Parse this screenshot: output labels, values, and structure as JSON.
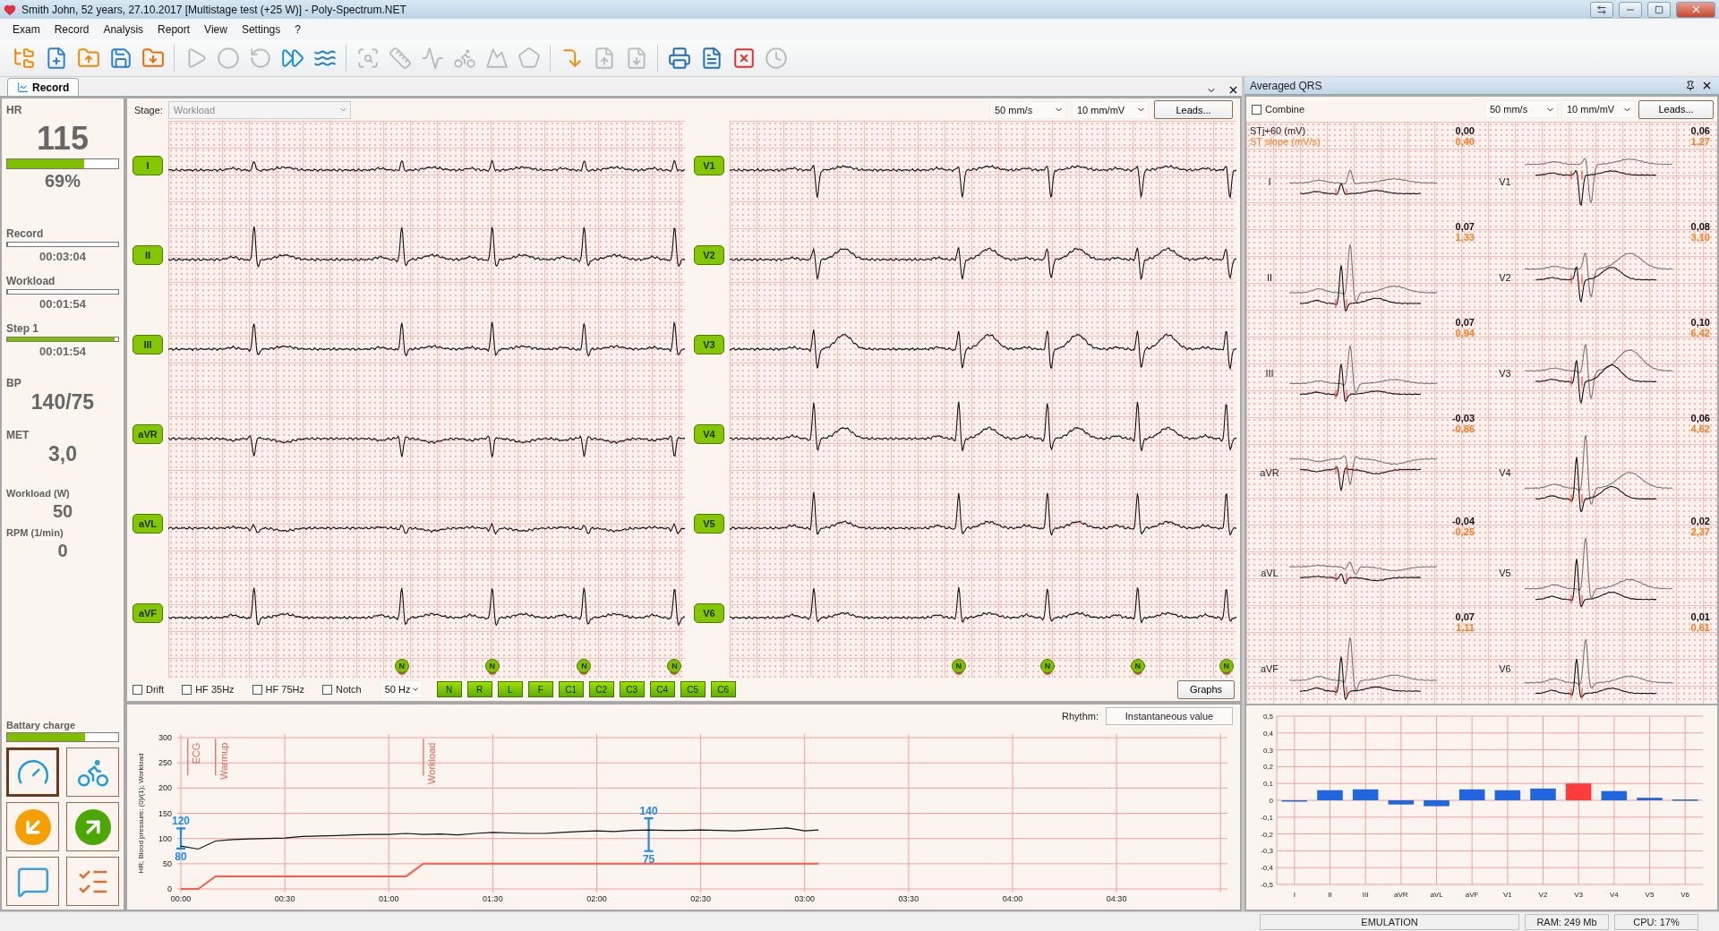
{
  "window": {
    "title": "Smith John, 52 years, 27.10.2017 [Multistage test (+25 W)] - Poly-Spectrum.NET"
  },
  "menu": [
    "Exam",
    "Record",
    "Analysis",
    "Report",
    "View",
    "Settings",
    "?"
  ],
  "toolbar": [
    {
      "kind": "folder-tree",
      "disabled": false
    },
    {
      "kind": "file-add",
      "disabled": false
    },
    {
      "kind": "folder-up",
      "disabled": false
    },
    {
      "kind": "save",
      "disabled": false
    },
    {
      "kind": "folder-down",
      "disabled": false
    },
    {
      "kind": "separator"
    },
    {
      "kind": "play",
      "disabled": true
    },
    {
      "kind": "stop",
      "disabled": true
    },
    {
      "kind": "undo",
      "disabled": true
    },
    {
      "kind": "fast-forward",
      "disabled": false
    },
    {
      "kind": "waves",
      "disabled": false
    },
    {
      "kind": "separator"
    },
    {
      "kind": "scan",
      "disabled": true
    },
    {
      "kind": "ruler",
      "disabled": true
    },
    {
      "kind": "pulse",
      "disabled": true
    },
    {
      "kind": "bicycle",
      "disabled": true
    },
    {
      "kind": "histogram",
      "disabled": true
    },
    {
      "kind": "pentagon",
      "disabled": true
    },
    {
      "kind": "separator"
    },
    {
      "kind": "step-down",
      "disabled": false
    },
    {
      "kind": "file-up",
      "disabled": true
    },
    {
      "kind": "file-down",
      "disabled": true
    },
    {
      "kind": "separator"
    },
    {
      "kind": "printer",
      "disabled": false
    },
    {
      "kind": "report",
      "disabled": false
    },
    {
      "kind": "close-window",
      "disabled": false
    },
    {
      "kind": "clock",
      "disabled": true
    }
  ],
  "document_tabs": [
    {
      "label": "Record",
      "selected": true
    }
  ],
  "sidebar": {
    "hr": {
      "label": "HR",
      "value": "115",
      "level": 0.69,
      "percent": "69%"
    },
    "timers": [
      {
        "label": "Record",
        "level": 0,
        "time": "00:03:04"
      },
      {
        "label": "Workload",
        "level": 0,
        "time": "00:01:54"
      },
      {
        "label": "Step 1",
        "level": 0.97,
        "time": "00:01:54"
      }
    ],
    "readings": [
      {
        "label": "BP",
        "value": "140/75",
        "kind": "large"
      },
      {
        "label": "MET",
        "value": "3,0",
        "kind": "large"
      },
      {
        "label": "Workload (W)",
        "value": "50",
        "kind": "small"
      },
      {
        "label": "RPM (1/min)",
        "value": "0",
        "kind": "small"
      }
    ],
    "battery": {
      "label": "Battary charge",
      "level": 0.7
    },
    "controls": [
      {
        "kind": "bp-monitor",
        "selected": true
      },
      {
        "kind": "bicycle",
        "selected": false
      },
      {
        "kind": "arrow-down-left",
        "selected": false
      },
      {
        "kind": "arrow-up-right",
        "selected": false
      },
      {
        "kind": "message",
        "selected": false
      },
      {
        "kind": "options-list",
        "selected": false
      }
    ]
  },
  "ecg": {
    "stage_label": "Stage:",
    "stage": {
      "value": "Workload",
      "disabled": true
    },
    "speed": "50 mm/s",
    "gain": "10 mm/mV",
    "leads_button": "Leads...",
    "columns": [
      {
        "leads": [
          "I",
          "II",
          "III",
          "aVR",
          "aVL",
          "aVF"
        ],
        "beat_marks": [
          "N",
          "N",
          "N",
          "N"
        ]
      },
      {
        "leads": [
          "V1",
          "V2",
          "V3",
          "V4",
          "V5",
          "V6"
        ],
        "beat_marks": [
          "N",
          "N",
          "N",
          "N"
        ]
      }
    ],
    "filters": [
      {
        "label": "Drift",
        "checked": false
      },
      {
        "label": "HF 35Hz",
        "checked": false
      },
      {
        "label": "HF 75Hz",
        "checked": false
      },
      {
        "label": "Notch",
        "checked": false
      }
    ],
    "mains": "50 Hz",
    "lead_buttons": [
      "N",
      "R",
      "L",
      "F",
      "C1",
      "C2",
      "C3",
      "C4",
      "C5",
      "C6"
    ],
    "graphs_button": "Graphs"
  },
  "trend": {
    "rhythm_label": "Rhythm:",
    "rhythm_mode": "Instantaneous value",
    "stage_marks": [
      "ECG",
      "Warmup",
      "Workload"
    ],
    "bp_marks": [
      {
        "high": "120",
        "low": "80"
      },
      {
        "high": "140",
        "low": "75"
      }
    ],
    "chart_data": {
      "type": "line",
      "ylabel": "HR; Blood pressure: (0)/(1); Workload",
      "grid": true,
      "x": [
        0,
        5,
        10,
        15,
        20,
        25,
        30,
        35,
        40,
        45,
        50,
        55,
        60,
        65,
        70,
        75,
        80,
        85,
        90,
        95,
        100,
        105,
        110,
        115,
        120,
        125,
        130,
        135,
        140,
        145,
        150,
        155,
        160,
        165,
        170,
        175,
        180,
        184
      ],
      "series": [
        {
          "color": "#111111",
          "values": [
            85,
            79,
            95,
            98,
            99,
            100,
            101,
            104,
            105,
            106,
            107,
            108,
            108,
            110,
            108,
            109,
            107,
            110,
            112,
            111,
            110,
            110,
            112,
            114,
            115,
            114,
            116,
            117,
            116,
            116,
            117,
            116,
            115,
            117,
            119,
            121,
            115,
            117
          ]
        },
        {
          "color": "#ff5a4a",
          "values": [
            0,
            0,
            25,
            25,
            25,
            25,
            25,
            25,
            25,
            25,
            25,
            25,
            25,
            25,
            50,
            50,
            50,
            50,
            50,
            50,
            50,
            50,
            50,
            50,
            50,
            50,
            50,
            50,
            50,
            50,
            50,
            50,
            50,
            50,
            50,
            50,
            50,
            50
          ]
        }
      ],
      "xlim": [
        0,
        302
      ],
      "ylim": [
        0,
        300
      ],
      "xticks": [
        {
          "value": 0,
          "label": "00:00"
        },
        {
          "value": 30,
          "label": "00:30"
        },
        {
          "value": 60,
          "label": "01:00"
        },
        {
          "value": 90,
          "label": "01:30"
        },
        {
          "value": 120,
          "label": "02:00"
        },
        {
          "value": 150,
          "label": "02:30"
        },
        {
          "value": 180,
          "label": "03:00"
        },
        {
          "value": 210,
          "label": "03:30"
        },
        {
          "value": 240,
          "label": "04:00"
        },
        {
          "value": 270,
          "label": "04:30"
        }
      ],
      "yticks": [
        0,
        50,
        100,
        150,
        200,
        250,
        300
      ]
    }
  },
  "averaged_qrs": {
    "title": "Averaged QRS",
    "combine": {
      "label": "Combine",
      "checked": false
    },
    "speed": "50 mm/s",
    "gain": "10 mm/mV",
    "leads_button": "Leads...",
    "stj_label": "STj+60 (mV)",
    "slope_label": "ST slope (mV/s)",
    "leads": [
      {
        "name": "I",
        "stj": "0,00",
        "slope": "0,40"
      },
      {
        "name": "V1",
        "stj": "0,06",
        "slope": "1,27"
      },
      {
        "name": "II",
        "stj": "0,07",
        "slope": "1,33"
      },
      {
        "name": "V2",
        "stj": "0,08",
        "slope": "3,10"
      },
      {
        "name": "III",
        "stj": "0,07",
        "slope": "0,94"
      },
      {
        "name": "V3",
        "stj": "0,10",
        "slope": "6,42"
      },
      {
        "name": "aVR",
        "stj": "-0,03",
        "slope": "-0,86"
      },
      {
        "name": "V4",
        "stj": "0,06",
        "slope": "4,62"
      },
      {
        "name": "aVL",
        "stj": "-0,04",
        "slope": "-0,25"
      },
      {
        "name": "V5",
        "stj": "0,02",
        "slope": "2,37"
      },
      {
        "name": "aVF",
        "stj": "0,07",
        "slope": "1,11"
      },
      {
        "name": "V6",
        "stj": "0,01",
        "slope": "0,61"
      }
    ],
    "chart_data": {
      "type": "bar",
      "stacked": true,
      "grid": true,
      "categories": [
        "I",
        "II",
        "III",
        "aVR",
        "aVL",
        "aVF",
        "V1",
        "V2",
        "V3",
        "V4",
        "V5",
        "V6"
      ],
      "series": [
        {
          "color": "#1f66e0",
          "values": [
            -0.005,
            0.06,
            0.065,
            -0.025,
            -0.035,
            0.065,
            0.06,
            0.07,
            null,
            0.055,
            0.015,
            0.005
          ]
        },
        {
          "color": "#ff3b3b",
          "values": [
            null,
            null,
            null,
            null,
            null,
            null,
            null,
            null,
            0.1,
            null,
            null,
            null
          ]
        }
      ],
      "ylim": [
        -0.5,
        0.5
      ],
      "yticks": [
        {
          "value": 0.5,
          "label": "0,5"
        },
        {
          "value": 0.4,
          "label": "0,4"
        },
        {
          "value": 0.3,
          "label": "0,3"
        },
        {
          "value": 0.2,
          "label": "0,2"
        },
        {
          "value": 0.1,
          "label": "0,1"
        },
        {
          "value": 0,
          "label": "0"
        },
        {
          "value": -0.1,
          "label": "-0,1"
        },
        {
          "value": -0.2,
          "label": "-0,2"
        },
        {
          "value": -0.3,
          "label": "-0,3"
        },
        {
          "value": -0.4,
          "label": "-0,4"
        },
        {
          "value": -0.5,
          "label": "-0,5"
        }
      ]
    }
  },
  "status_bar": [
    "EMULATION",
    "RAM: 249 Mb",
    "CPU: 17%"
  ]
}
